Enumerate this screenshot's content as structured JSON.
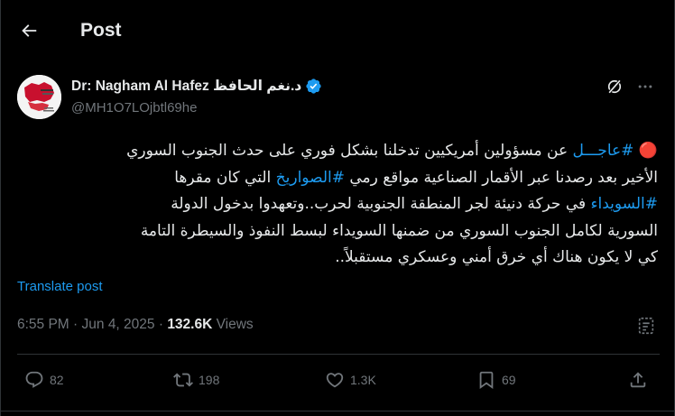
{
  "header": {
    "title": "Post"
  },
  "author": {
    "display_name": "Dr: Nagham Al Hafez د.نغم الحافظ",
    "handle": "@MH1O7LOjbtl69he",
    "verified": true,
    "accent_color": "#1d9bf0"
  },
  "tweet": {
    "emoji": "🔴",
    "line1_hashtag": "#عاجـــل",
    "line1_text": " عن مسؤولين أمريكيين تدخلنا بشكل فوري على حدث الجنوب السوري",
    "line2_pre": "الأخير بعد رصدنا عبر الأقمار الصناعية مواقع رمي ",
    "line2_hashtag": "#الصواريخ",
    "line2_post": " التي كان مقرها",
    "line3_hashtag": "#السويداء",
    "line3_text": " في حركة دنيئة لجر المنطقة الجنوبية لحرب..وتعهدوا بدخول الدولة",
    "line4": "السورية لكامل الجنوب السوري من ضمنها السويداء لبسط النفوذ والسيطرة التامة",
    "line5": "كي لا يكون هناك أي خرق أمني وعسكري مستقبلاً.."
  },
  "translate_label": "Translate post",
  "meta": {
    "time": "6:55 PM",
    "separator": " · ",
    "date": "Jun 4, 2025",
    "separator2": " · ",
    "views_count": "132.6K",
    "views_label": " Views"
  },
  "actions": {
    "replies": "82",
    "retweets": "198",
    "likes": "1.3K",
    "bookmarks": "69"
  },
  "icons": {
    "back": "arrow-left-icon",
    "grok": "grok-icon",
    "more": "more-icon",
    "analytics": "analytics-icon",
    "reply": "reply-icon",
    "retweet": "retweet-icon",
    "like": "heart-icon",
    "bookmark": "bookmark-icon",
    "share": "share-icon",
    "verified": "verified-badge-icon"
  }
}
